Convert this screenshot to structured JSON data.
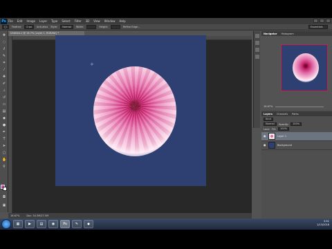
{
  "app": {
    "logo": "Ps",
    "menu": [
      "File",
      "Edit",
      "Image",
      "Layer",
      "Type",
      "Select",
      "Filter",
      "3D",
      "View",
      "Window",
      "Help"
    ],
    "workspace": "Essentials"
  },
  "options": {
    "feather_label": "Feather:",
    "feather_value": "0 px",
    "antialias_label": "Anti-alias",
    "style_label": "Style:",
    "style_value": "Normal",
    "width_label": "Width:",
    "height_label": "Height:",
    "refine_label": "Refine Edge..."
  },
  "document": {
    "tab_title": "Untitled-1 @ 16.7% (Layer 1, RGB/8#) *",
    "zoom": "16.67%",
    "doc_info": "Doc: 34.3M/27.5M"
  },
  "navigator": {
    "tabs": [
      "Navigator",
      "Histogram"
    ],
    "zoom": "16.67%"
  },
  "layers": {
    "tabs": [
      "Layers",
      "Channels",
      "Paths"
    ],
    "kind_label": "Kind",
    "blend_mode": "Normal",
    "opacity_label": "Opacity:",
    "opacity_value": "100%",
    "lock_label": "Lock:",
    "fill_label": "Fill:",
    "fill_value": "100%",
    "items": [
      {
        "name": "Layer 1"
      },
      {
        "name": "Background"
      }
    ]
  },
  "colors": {
    "foreground": "#c94fc0",
    "background": "#ffffff",
    "canvas": "#2e3f72"
  },
  "taskbar": {
    "time": "5:51",
    "date": "1/13/2016"
  }
}
